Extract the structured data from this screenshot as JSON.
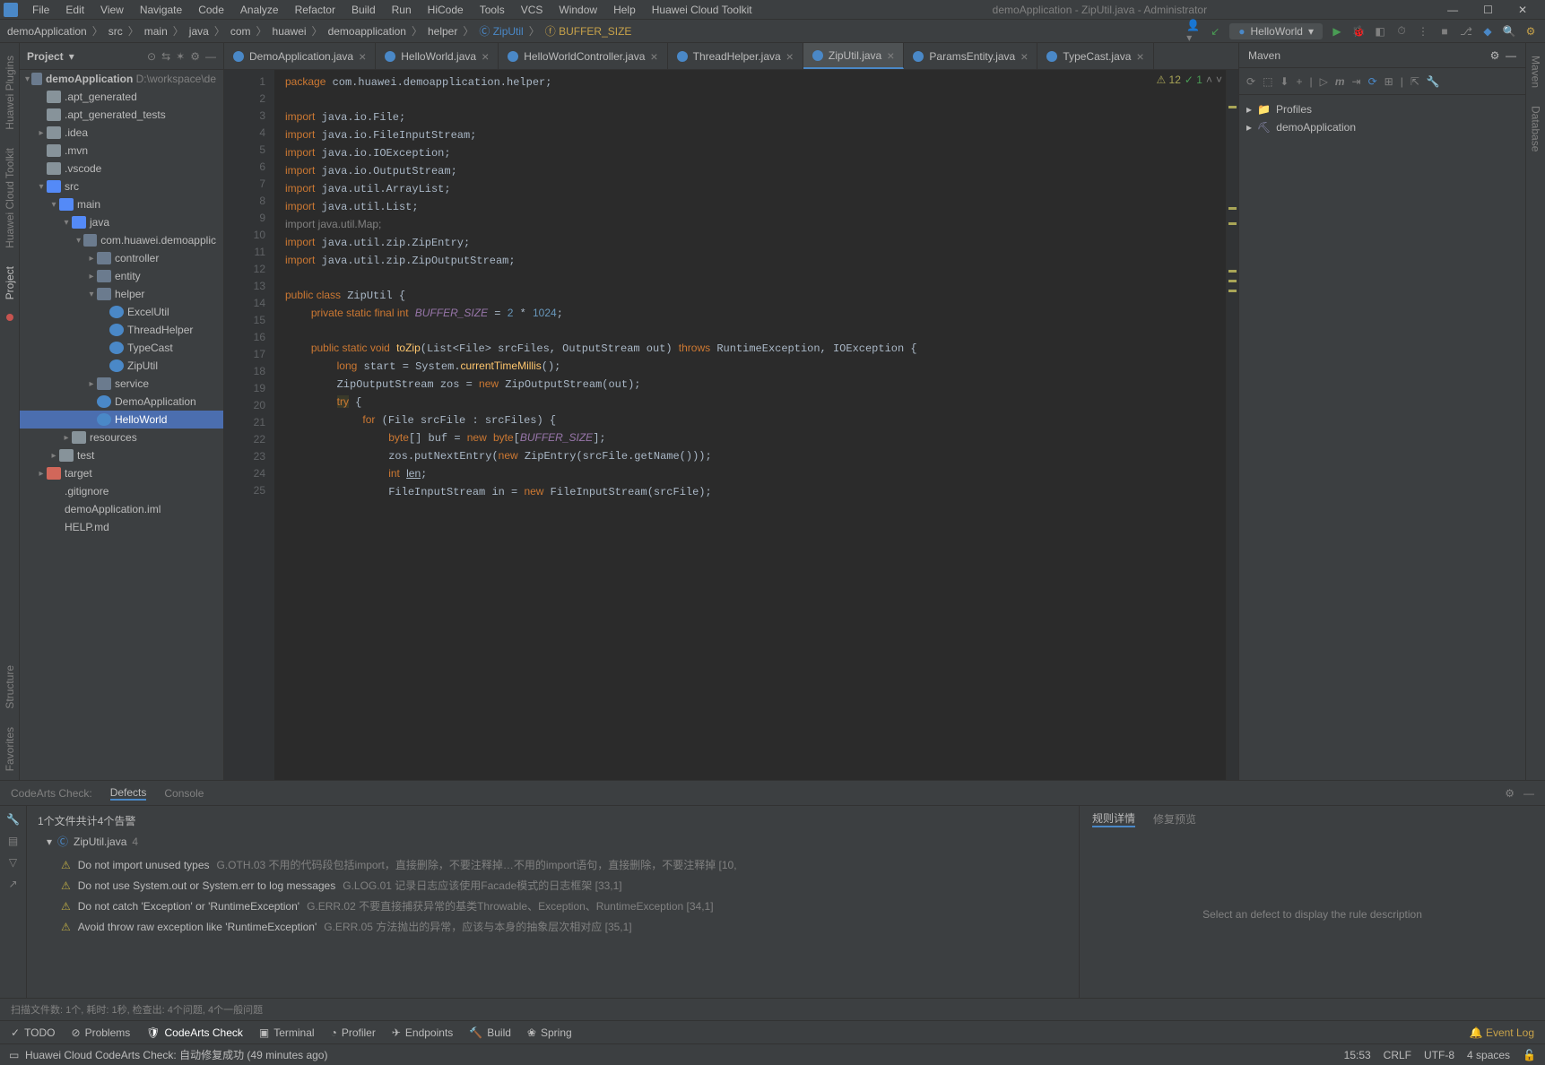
{
  "window_title": "demoApplication - ZipUtil.java - Administrator",
  "menu": [
    "File",
    "Edit",
    "View",
    "Navigate",
    "Code",
    "Analyze",
    "Refactor",
    "Build",
    "Run",
    "HiCode",
    "Tools",
    "VCS",
    "Window",
    "Help",
    "Huawei Cloud Toolkit"
  ],
  "breadcrumb": [
    "demoApplication",
    "src",
    "main",
    "java",
    "com",
    "huawei",
    "demoapplication",
    "helper",
    "ZipUtil",
    "BUFFER_SIZE"
  ],
  "run_config": "HelloWorld",
  "left_tabs": [
    "Huawei Plugins",
    "Huawei Cloud Toolkit",
    "Project"
  ],
  "project_header": "Project",
  "tree": {
    "root": {
      "label": "demoApplication",
      "hint": "D:\\workspace\\de"
    },
    "items": [
      {
        "l": 1,
        "a": "",
        "ic": "folder",
        "t": ".apt_generated"
      },
      {
        "l": 1,
        "a": "",
        "ic": "folder",
        "t": ".apt_generated_tests"
      },
      {
        "l": 1,
        "a": "closed",
        "ic": "folder",
        "t": ".idea"
      },
      {
        "l": 1,
        "a": "",
        "ic": "folder",
        "t": ".mvn"
      },
      {
        "l": 1,
        "a": "",
        "ic": "folder",
        "t": ".vscode"
      },
      {
        "l": 1,
        "a": "open",
        "ic": "folder src",
        "t": "src"
      },
      {
        "l": 2,
        "a": "open",
        "ic": "folder src",
        "t": "main"
      },
      {
        "l": 3,
        "a": "open",
        "ic": "folder src",
        "t": "java"
      },
      {
        "l": 4,
        "a": "open",
        "ic": "pkg",
        "t": "com.huawei.demoapplic"
      },
      {
        "l": 5,
        "a": "closed",
        "ic": "pkg",
        "t": "controller"
      },
      {
        "l": 5,
        "a": "closed",
        "ic": "pkg",
        "t": "entity"
      },
      {
        "l": 5,
        "a": "open",
        "ic": "pkg",
        "t": "helper"
      },
      {
        "l": 6,
        "a": "",
        "ic": "jclass",
        "t": "ExcelUtil"
      },
      {
        "l": 6,
        "a": "",
        "ic": "jclass",
        "t": "ThreadHelper"
      },
      {
        "l": 6,
        "a": "",
        "ic": "jclass",
        "t": "TypeCast"
      },
      {
        "l": 6,
        "a": "",
        "特": "",
        "ic": "jclass",
        "t": "ZipUtil"
      },
      {
        "l": 5,
        "a": "closed",
        "ic": "pkg",
        "t": "service"
      },
      {
        "l": 5,
        "a": "",
        "ic": "jclass",
        "t": "DemoApplication"
      },
      {
        "l": 5,
        "a": "",
        "ic": "jclass",
        "t": "HelloWorld",
        "sel": true
      },
      {
        "l": 3,
        "a": "closed",
        "ic": "folder",
        "t": "resources"
      },
      {
        "l": 2,
        "a": "closed",
        "ic": "folder",
        "t": "test"
      },
      {
        "l": 1,
        "a": "closed",
        "ic": "folder ex",
        "t": "target"
      },
      {
        "l": 1,
        "a": "",
        "ic": "file",
        "t": ".gitignore"
      },
      {
        "l": 1,
        "a": "",
        "ic": "file",
        "t": "demoApplication.iml"
      },
      {
        "l": 1,
        "a": "",
        "ic": "file",
        "t": "HELP.md"
      }
    ]
  },
  "editor_tabs": [
    {
      "label": "DemoApplication.java"
    },
    {
      "label": "HelloWorld.java"
    },
    {
      "label": "HelloWorldController.java"
    },
    {
      "label": "ThreadHelper.java"
    },
    {
      "label": "ZipUtil.java",
      "active": true
    },
    {
      "label": "ParamsEntity.java"
    },
    {
      "label": "TypeCast.java"
    }
  ],
  "code_info": {
    "warnings": "12",
    "ok": "1"
  },
  "code_lines": [
    1,
    2,
    3,
    4,
    5,
    6,
    7,
    8,
    9,
    10,
    11,
    12,
    13,
    14,
    15,
    16,
    17,
    18,
    19,
    20,
    21,
    22,
    23,
    24,
    25
  ],
  "maven": {
    "title": "Maven",
    "profiles": "Profiles",
    "project": "demoApplication"
  },
  "right_tabs": [
    "Maven",
    "Database"
  ],
  "bottom": {
    "tabs": [
      "CodeArts Check:",
      "Defects",
      "Console"
    ],
    "header": "1个文件共计4个告警",
    "file": "ZipUtil.java",
    "file_count": "4",
    "rows": [
      {
        "msg": "Do not import unused types",
        "rule": "G.OTH.03 不用的代码段包括import，直接删除，不要注释掉…不用的import语句，直接删除，不要注释掉 [10,"
      },
      {
        "msg": "Do not use System.out or System.err to log messages",
        "rule": "G.LOG.01 记录日志应该使用Facade模式的日志框架 [33,1]"
      },
      {
        "msg": "Do not catch 'Exception' or 'RuntimeException'",
        "rule": "G.ERR.02 不要直接捕获异常的基类Throwable、Exception、RuntimeException [34,1]"
      },
      {
        "msg": "Avoid throw raw exception like 'RuntimeException'",
        "rule": "G.ERR.05 方法抛出的异常，应该与本身的抽象层次相对应 [35,1]"
      }
    ],
    "detail_tabs": [
      "规则详情",
      "修复预览"
    ],
    "detail_empty": "Select an defect to display the rule description",
    "scanline": "扫描文件数: 1个,  耗时: 1秒,  检查出: 4个问题,  4个一般问题"
  },
  "toolwindows": [
    "TODO",
    "Problems",
    "CodeArts Check",
    "Terminal",
    "Profiler",
    "Endpoints",
    "Build",
    "Spring"
  ],
  "eventlog": "Event Log",
  "status": {
    "msg": "Huawei Cloud CodeArts Check: 自动修复成功 (49 minutes ago)",
    "pos": "15:53",
    "crlf": "CRLF",
    "enc": "UTF-8",
    "indent": "4 spaces"
  }
}
